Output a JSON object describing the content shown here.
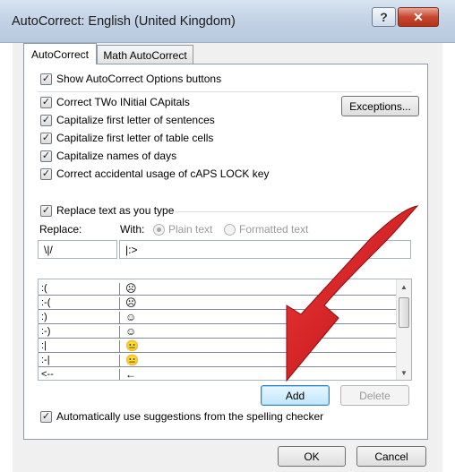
{
  "window": {
    "title": "AutoCorrect: English (United Kingdom)",
    "help_glyph": "?",
    "close_glyph": "✕"
  },
  "tabs": [
    {
      "label": "AutoCorrect",
      "active": true
    },
    {
      "label": "Math AutoCorrect",
      "active": false
    }
  ],
  "options": {
    "show_buttons": {
      "label": "Show AutoCorrect Options buttons",
      "checked": true
    },
    "items": [
      {
        "label": "Correct TWo INitial CApitals",
        "checked": true
      },
      {
        "label": "Capitalize first letter of sentences",
        "checked": true
      },
      {
        "label": "Capitalize first letter of table cells",
        "checked": true
      },
      {
        "label": "Capitalize names of days",
        "checked": true
      },
      {
        "label": "Correct accidental usage of cAPS LOCK key",
        "checked": true
      }
    ],
    "exceptions_label": "Exceptions..."
  },
  "replace": {
    "section_label": "Replace text as you type",
    "checked": true,
    "replace_label": "Replace:",
    "with_label": "With:",
    "plain_text_label": "Plain text",
    "formatted_text_label": "Formatted text",
    "replace_value": "\\|/",
    "with_value": "|:>",
    "rows": [
      {
        "replace": ":(",
        "with": "☹"
      },
      {
        "replace": ":-(",
        "with": "☹"
      },
      {
        "replace": ":)",
        "with": "☺"
      },
      {
        "replace": ":-)",
        "with": "☺"
      },
      {
        "replace": ":|",
        "with": "😐"
      },
      {
        "replace": ":-|",
        "with": "😐"
      },
      {
        "replace": "<--",
        "with": "←"
      }
    ],
    "add_label": "Add",
    "delete_label": "Delete"
  },
  "spelling": {
    "label": "Automatically use suggestions from the spelling checker",
    "checked": true
  },
  "footer": {
    "ok_label": "OK",
    "cancel_label": "Cancel"
  },
  "colors": {
    "arrow": "#e0141c",
    "accent": "#3c7fb1"
  }
}
